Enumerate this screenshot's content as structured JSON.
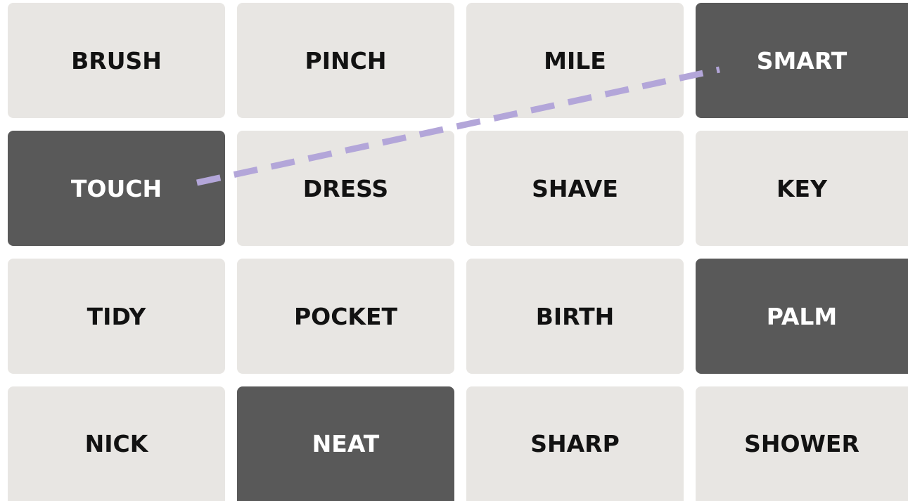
{
  "board": {
    "tiles": [
      {
        "word": "BRUSH",
        "selected": false
      },
      {
        "word": "PINCH",
        "selected": false
      },
      {
        "word": "MILE",
        "selected": false
      },
      {
        "word": "SMART",
        "selected": true
      },
      {
        "word": "TOUCH",
        "selected": true
      },
      {
        "word": "DRESS",
        "selected": false
      },
      {
        "word": "SHAVE",
        "selected": false
      },
      {
        "word": "KEY",
        "selected": false
      },
      {
        "word": "TIDY",
        "selected": false
      },
      {
        "word": "POCKET",
        "selected": false
      },
      {
        "word": "BIRTH",
        "selected": false
      },
      {
        "word": "PALM",
        "selected": true
      },
      {
        "word": "NICK",
        "selected": false
      },
      {
        "word": "NEAT",
        "selected": true
      },
      {
        "word": "SHARP",
        "selected": false
      },
      {
        "word": "SHOWER",
        "selected": false
      }
    ]
  },
  "colors": {
    "tile": "#e8e6e3",
    "tile_selected": "#595959",
    "text": "#121212",
    "text_selected": "#ffffff",
    "connector": "#b3a6d9"
  }
}
